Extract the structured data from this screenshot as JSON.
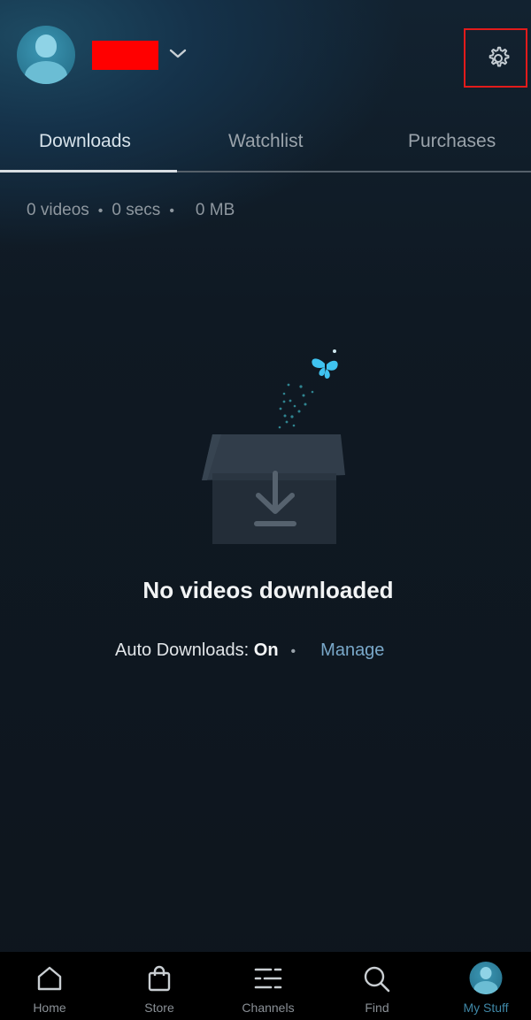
{
  "header": {
    "profile_name_redacted": true,
    "icons": {
      "avatar": "user-avatar-icon",
      "chevron": "chevron-down-icon",
      "settings": "gear-icon"
    }
  },
  "tabs": [
    {
      "label": "Downloads",
      "active": true
    },
    {
      "label": "Watchlist",
      "active": false
    },
    {
      "label": "Purchases",
      "active": false
    }
  ],
  "stats": {
    "videos": "0 videos",
    "duration": "0 secs",
    "size": "0 MB",
    "separator": "•"
  },
  "empty_state": {
    "illustration": "open-box-download-icon",
    "title": "No videos downloaded",
    "auto_downloads_label": "Auto Downloads:",
    "auto_downloads_value": "On",
    "separator": "•",
    "manage_link": "Manage"
  },
  "bottom_nav": [
    {
      "label": "Home",
      "icon": "home-icon",
      "active": false
    },
    {
      "label": "Store",
      "icon": "shopping-bag-icon",
      "active": false
    },
    {
      "label": "Channels",
      "icon": "channels-icon",
      "active": false
    },
    {
      "label": "Find",
      "icon": "search-icon",
      "active": false
    },
    {
      "label": "My Stuff",
      "icon": "user-avatar-icon",
      "active": true
    }
  ],
  "colors": {
    "background": "#0f171f",
    "accent_link": "#79a8c9",
    "active_nav": "#3f87a6",
    "highlight_box": "#e21b1b",
    "redaction": "#ff0000",
    "butterfly": "#3fc3f0"
  }
}
